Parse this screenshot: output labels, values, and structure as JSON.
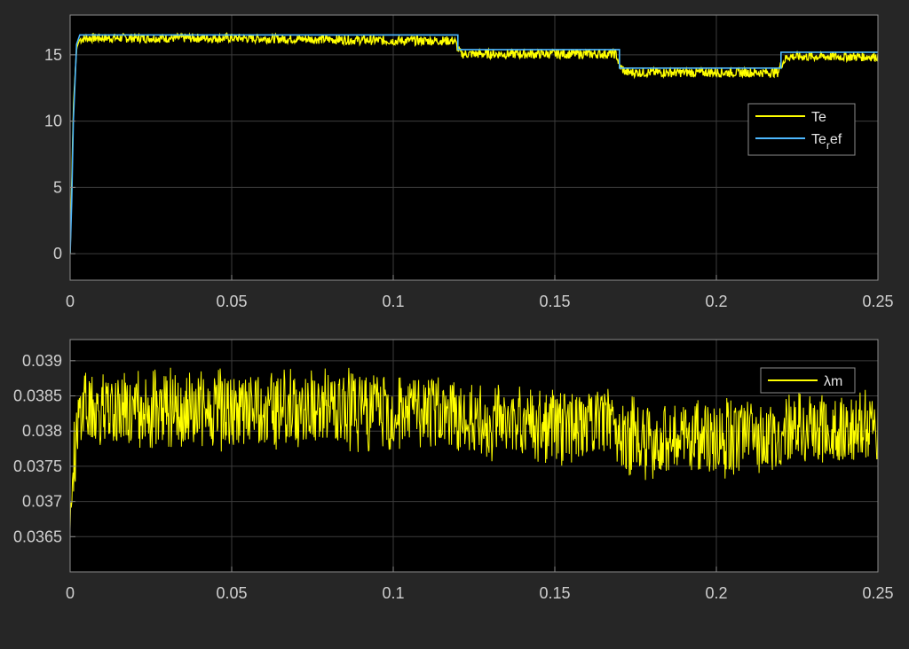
{
  "chart_data": [
    {
      "type": "line",
      "title": "",
      "xlabel": "",
      "ylabel": "",
      "xlim": [
        0,
        0.25
      ],
      "ylim": [
        -2,
        18
      ],
      "xticks": [
        0,
        0.05,
        0.1,
        0.15,
        0.2,
        0.25
      ],
      "xtick_labels": [
        "0",
        "0.05",
        "0.1",
        "0.15",
        "0.2",
        "0.25"
      ],
      "yticks": [
        0,
        5,
        10,
        15
      ],
      "ytick_labels": [
        "0",
        "5",
        "10",
        "15"
      ],
      "grid": true,
      "legend_position": "right",
      "series": [
        {
          "name": "Te",
          "color": "#ffff00",
          "x": [
            0,
            0.001,
            0.002,
            0.003,
            0.005,
            0.02,
            0.05,
            0.08,
            0.1,
            0.119,
            0.12,
            0.121,
            0.15,
            0.169,
            0.17,
            0.172,
            0.2,
            0.219,
            0.22,
            0.222,
            0.25
          ],
          "y": [
            0,
            11,
            15.5,
            16.2,
            16.3,
            16.3,
            16.3,
            16.2,
            16.1,
            16.1,
            15.5,
            15.1,
            15.1,
            15.1,
            14.2,
            13.7,
            13.7,
            13.7,
            14.3,
            14.9,
            14.9
          ],
          "ripple": 0.35
        },
        {
          "name": "Te_ref",
          "color": "#4db8ff",
          "x": [
            0,
            0.0005,
            0.001,
            0.002,
            0.003,
            0.12,
            0.12,
            0.17,
            0.17,
            0.22,
            0.22,
            0.25
          ],
          "y": [
            0,
            4,
            10,
            15.8,
            16.5,
            16.5,
            15.4,
            15.4,
            14.0,
            14.0,
            15.2,
            15.2
          ]
        }
      ],
      "legend": [
        {
          "label": "Te",
          "color": "#ffff00"
        },
        {
          "label_main": "Te",
          "label_sub": "r",
          "label_tail": "ef",
          "color": "#4db8ff"
        }
      ]
    },
    {
      "type": "line",
      "title": "",
      "xlabel": "",
      "ylabel": "",
      "xlim": [
        0,
        0.25
      ],
      "ylim": [
        0.036,
        0.0393
      ],
      "xticks": [
        0,
        0.05,
        0.1,
        0.15,
        0.2,
        0.25
      ],
      "xtick_labels": [
        "0",
        "0.05",
        "0.1",
        "0.15",
        "0.2",
        "0.25"
      ],
      "yticks": [
        0.0365,
        0.037,
        0.0375,
        0.038,
        0.0385,
        0.039
      ],
      "ytick_labels": [
        "0.0365",
        "0.037",
        "0.0375",
        "0.038",
        "0.0385",
        "0.039"
      ],
      "grid": true,
      "legend_position": "top-right",
      "series": [
        {
          "name": "λm",
          "color": "#ffff00",
          "x": [
            0,
            0.001,
            0.003,
            0.05,
            0.1,
            0.12,
            0.121,
            0.15,
            0.17,
            0.171,
            0.2,
            0.22,
            0.221,
            0.25
          ],
          "y": [
            0.0366,
            0.0375,
            0.0383,
            0.0383,
            0.0383,
            0.0383,
            0.0381,
            0.0381,
            0.0381,
            0.0379,
            0.0379,
            0.0379,
            0.038,
            0.038
          ],
          "band_upper": [
            0.0366,
            0.0388,
            0.0389,
            0.0389,
            0.0389,
            0.0388,
            0.0387,
            0.0386,
            0.0386,
            0.0385,
            0.0385,
            0.0384,
            0.0386,
            0.0386
          ],
          "band_lower": [
            0.0366,
            0.0373,
            0.0378,
            0.0377,
            0.0377,
            0.0377,
            0.0376,
            0.0375,
            0.0375,
            0.0373,
            0.0373,
            0.0374,
            0.0375,
            0.0375
          ]
        }
      ],
      "legend": [
        {
          "label": "λm",
          "color": "#ffff00"
        }
      ]
    }
  ]
}
